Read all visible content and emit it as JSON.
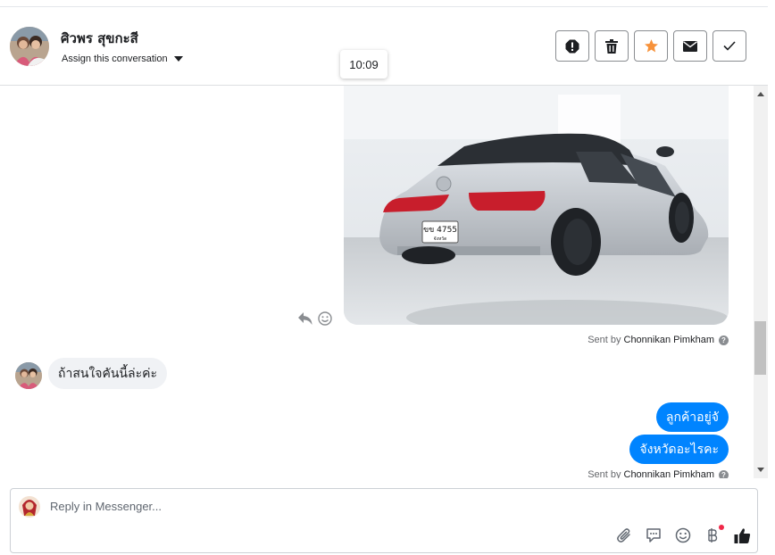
{
  "header": {
    "contact_name": "ศิวพร สุขกะสี",
    "assign_label": "Assign this conversation",
    "actions": [
      "spam-icon",
      "trash-icon",
      "star-icon",
      "envelope-icon",
      "check-icon"
    ],
    "star_color": "#f7923a"
  },
  "tooltip": {
    "time": "10:09"
  },
  "conversation": {
    "car_photo": {
      "plate_line1": "ขข 4755",
      "plate_line2": "จังหวัด"
    },
    "sent_by_prefix": "Sent by",
    "agent_name": "Chonnikan Pimkham",
    "incoming": {
      "text": "ถ้าสนใจคันนี้ล่ะค่ะ"
    },
    "outgoing": [
      {
        "text": "ลูกค้าอยู่จั"
      },
      {
        "text": "จังหวัดอะไรคะ"
      }
    ],
    "outgoing_color": "#0084ff"
  },
  "reply": {
    "placeholder": "Reply in Messenger...",
    "tools": [
      "paperclip-icon",
      "saved-replies-icon",
      "emoji-icon",
      "baht-icon",
      "thumbs-up-icon"
    ]
  }
}
